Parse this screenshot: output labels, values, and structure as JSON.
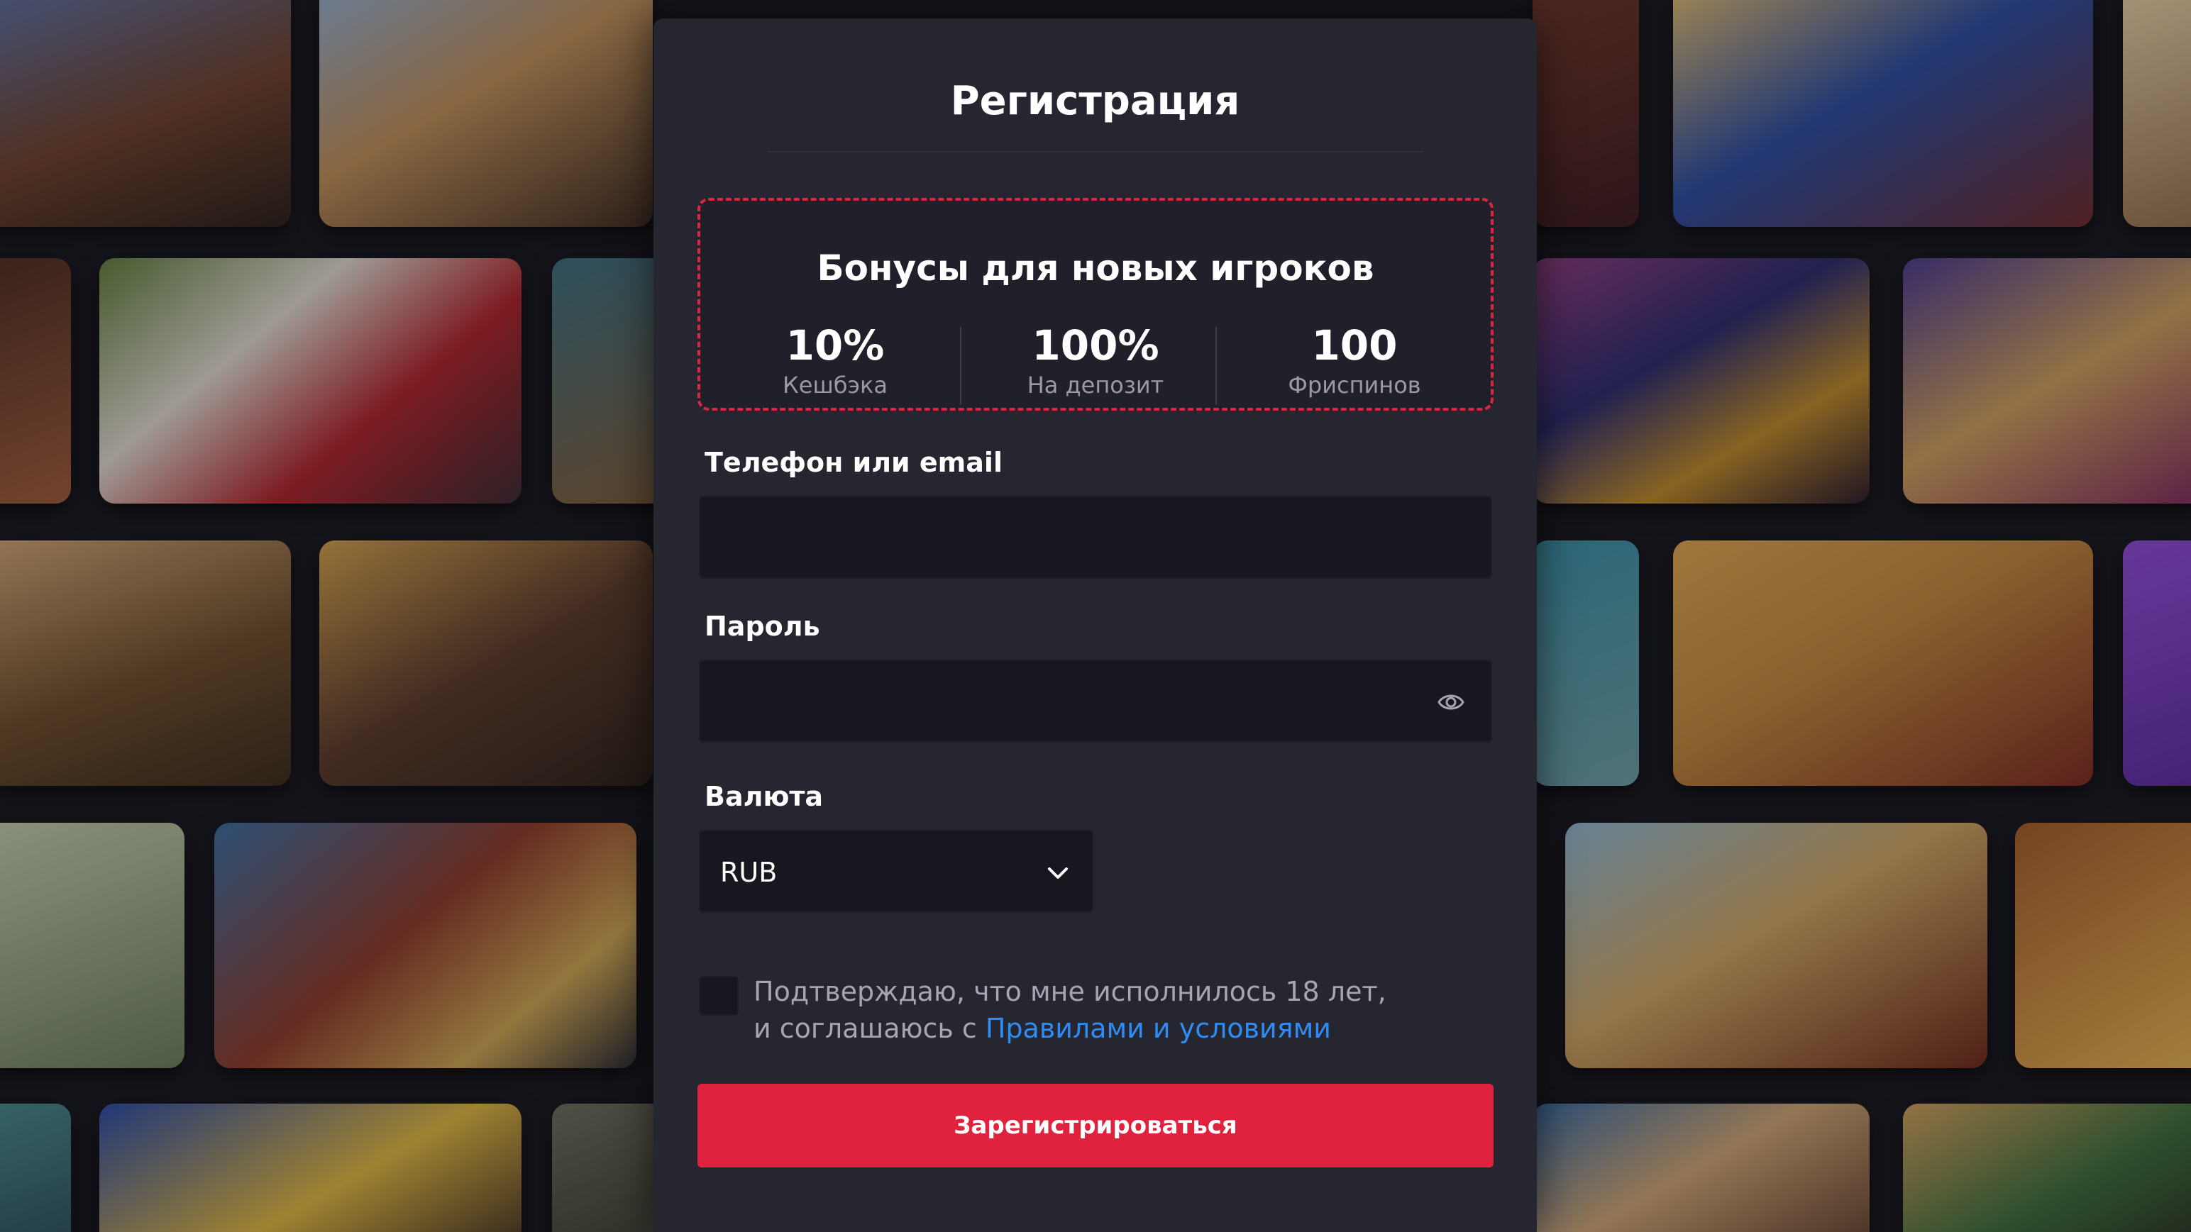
{
  "modal": {
    "title": "Регистрация"
  },
  "bonus": {
    "title": "Бонусы для новых игроков",
    "stats": [
      {
        "value": "10%",
        "label": "Кешбэка"
      },
      {
        "value": "100%",
        "label": "На депозит"
      },
      {
        "value": "100",
        "label": "Фриспинов"
      }
    ]
  },
  "form": {
    "login_label": "Телефон или email",
    "login_value": "",
    "password_label": "Пароль",
    "password_value": "",
    "currency_label": "Валюта",
    "currency_value": "RUB",
    "agree_line1": "Подтверждаю, что мне исполнилось 18 лет,",
    "agree_line2_prefix": "и соглашаюсь с ",
    "agree_link": "Правилами и условиями",
    "submit_label": "Зарегистрироваться"
  },
  "colors": {
    "accent": "#e1223f",
    "link": "#2f8cf5",
    "panel": "#262631",
    "input": "#17171f"
  },
  "icons": {
    "password_toggle": "eye-icon",
    "currency_dropdown": "chevron-down-icon"
  }
}
